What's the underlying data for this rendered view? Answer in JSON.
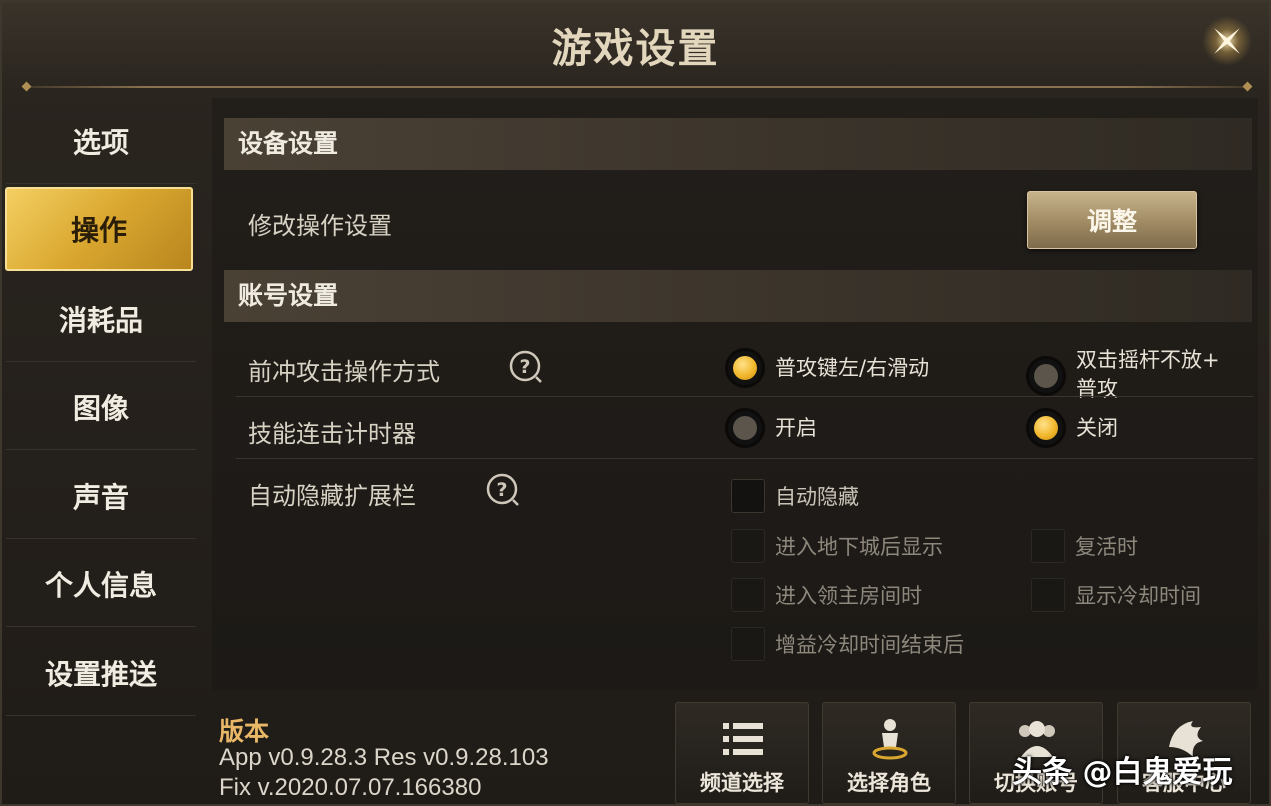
{
  "window": {
    "title": "游戏设置"
  },
  "sidebar": {
    "items": [
      {
        "label": "选项"
      },
      {
        "label": "操作",
        "active": true
      },
      {
        "label": "消耗品"
      },
      {
        "label": "图像"
      },
      {
        "label": "声音"
      },
      {
        "label": "个人信息"
      },
      {
        "label": "设置推送"
      }
    ]
  },
  "device_settings": {
    "header": "设备设置",
    "modify_label": "修改操作设置",
    "adjust_button": "调整"
  },
  "account_settings": {
    "header": "账号设置",
    "dash_attack": {
      "label": "前冲攻击操作方式",
      "options": [
        "普攻键左/右滑动",
        "双击摇杆不放+普攻"
      ],
      "option2_line1": "双击摇杆不放+",
      "option2_line2": "普攻",
      "selected": "普攻键左/右滑动"
    },
    "combo_timer": {
      "label": "技能连击计时器",
      "options": [
        "开启",
        "关闭"
      ],
      "selected": "关闭"
    },
    "auto_hide": {
      "label": "自动隐藏扩展栏",
      "checkboxes": {
        "auto_hide": "自动隐藏",
        "enter_dungeon": "进入地下城后显示",
        "revive": "复活时",
        "boss_room": "进入领主房间时",
        "show_cooldown": "显示冷却时间",
        "buff_cooldown_end": "增益冷却时间结束后"
      }
    }
  },
  "footer": {
    "version_title": "版本",
    "version_line1": "App v0.9.28.3 Res v0.9.28.103",
    "version_line2": "Fix v.2020.07.07.166380",
    "buttons": {
      "channel": "频道选择",
      "character": "选择角色",
      "account": "切换账号",
      "support": "客服中心"
    }
  },
  "watermark": "头条 @白鬼爱玩",
  "colors": {
    "accent_gold": "#f1b72c",
    "active_tab": "#d9a72f",
    "version_title": "#e9b867"
  }
}
